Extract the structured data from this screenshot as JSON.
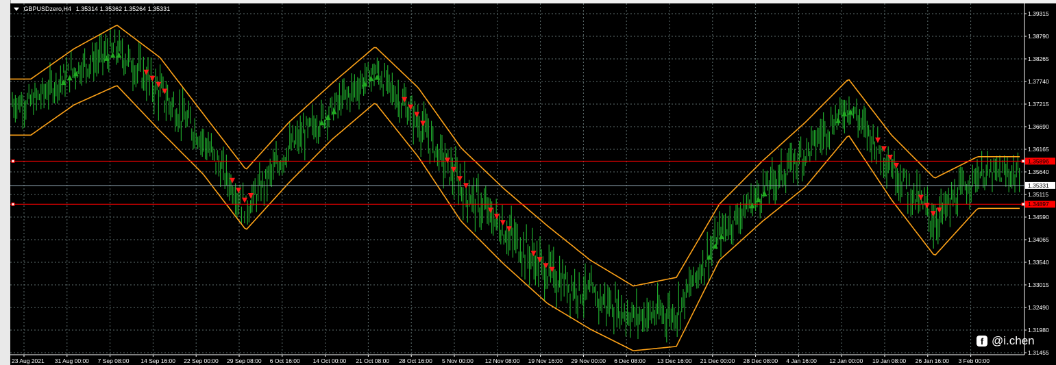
{
  "chart_title": "GBPUSDzero,H4",
  "ohlc": "1.35314 1.35362 1.35264 1.35331",
  "price_ticks": [
    "1.39315",
    "1.38790",
    "1.38265",
    "1.37740",
    "1.37215",
    "1.36690",
    "1.36165",
    "1.35640",
    "1.35115",
    "1.34590",
    "1.34065",
    "1.33540",
    "1.33015",
    "1.32490",
    "1.31980",
    "1.31455"
  ],
  "time_ticks": [
    "23 Aug 2021",
    "31 Aug 00:00",
    "7 Sep 08:00",
    "14 Sep 16:00",
    "22 Sep 00:00",
    "29 Sep 08:00",
    "6 Oct 16:00",
    "14 Oct 00:00",
    "21 Oct 08:00",
    "28 Oct 16:00",
    "5 Nov 00:00",
    "12 Nov 08:00",
    "19 Nov 16:00",
    "29 Nov 00:00",
    "6 Dec 08:00",
    "13 Dec 16:00",
    "21 Dec 00:00",
    "28 Dec 08:00",
    "4 Jan 16:00",
    "12 Jan 00:00",
    "19 Jan 08:00",
    "26 Jan 16:00",
    "3 Feb 00:00"
  ],
  "levels": {
    "upper_label": "1.35896",
    "current_label": "1.35331",
    "lower_label": "1.34897"
  },
  "watermark": {
    "icon": "facebook-icon",
    "text": "@i.chen"
  },
  "colors": {
    "background": "#000000",
    "grid": "#5f6f6f",
    "candle": "#1fa82c",
    "band": "#ffa318",
    "level_line": "#ff0000",
    "current_line": "#8ea2b0",
    "buy_arrow": "#22aa22",
    "sell_arrow": "#ff1a1a"
  },
  "chart_data": {
    "type": "line",
    "symbol": "GBPUSDzero",
    "timeframe": "H4",
    "ylim": [
      1.31455,
      1.39315
    ],
    "x": [
      "23 Aug 2021",
      "31 Aug 00:00",
      "7 Sep 08:00",
      "14 Sep 16:00",
      "22 Sep 00:00",
      "29 Sep 08:00",
      "6 Oct 16:00",
      "14 Oct 00:00",
      "21 Oct 08:00",
      "28 Oct 16:00",
      "5 Nov 00:00",
      "12 Nov 08:00",
      "19 Nov 16:00",
      "29 Nov 00:00",
      "6 Dec 08:00",
      "13 Dec 16:00",
      "21 Dec 00:00",
      "28 Dec 08:00",
      "4 Jan 16:00",
      "12 Jan 00:00",
      "19 Jan 08:00",
      "26 Jan 16:00",
      "3 Feb 00:00"
    ],
    "series": [
      {
        "values": [
          1.3725,
          1.38,
          1.385,
          1.375,
          1.364,
          1.348,
          1.362,
          1.371,
          1.38,
          1.368,
          1.353,
          1.343,
          1.333,
          1.328,
          1.323,
          1.324,
          1.342,
          1.352,
          1.361,
          1.372,
          1.358,
          1.345,
          1.356
        ]
      },
      {
        "values": [
          1.378,
          1.385,
          1.3905,
          1.383,
          1.37,
          1.357,
          1.368,
          1.377,
          1.3855,
          1.376,
          1.362,
          1.3525,
          1.344,
          1.336,
          1.33,
          1.332,
          1.349,
          1.359,
          1.368,
          1.378,
          1.365,
          1.355,
          1.36
        ]
      },
      {
        "values": [
          1.365,
          1.372,
          1.3765,
          1.366,
          1.356,
          1.343,
          1.354,
          1.364,
          1.3725,
          1.36,
          1.345,
          1.335,
          1.326,
          1.32,
          1.315,
          1.316,
          1.336,
          1.345,
          1.353,
          1.365,
          1.35,
          1.337,
          1.348
        ]
      }
    ],
    "horizontal_levels": [
      1.35896,
      1.35331,
      1.34897
    ],
    "sell_signals_at": [
      3,
      5,
      9,
      10,
      11,
      12,
      20,
      21
    ],
    "buy_signals_at": [
      1,
      2,
      7,
      8,
      16,
      17,
      19
    ]
  }
}
